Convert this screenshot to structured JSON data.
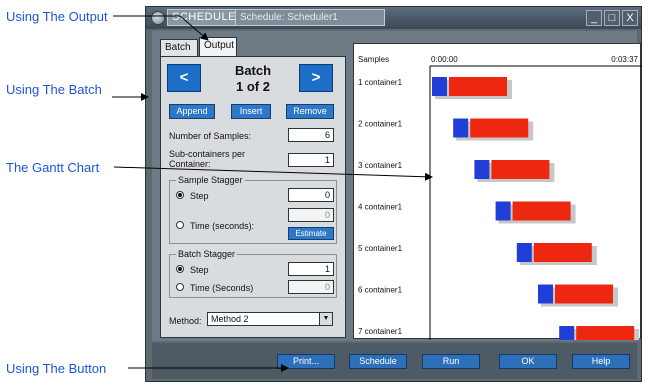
{
  "callouts": {
    "output": "Using The Output",
    "batch": "Using The Batch",
    "gantt": "The Gantt Chart",
    "button": "Using The Button"
  },
  "window": {
    "app_name": "SCHEDULE",
    "title": "Schedule: Scheduler1",
    "min_glyph": "_",
    "max_glyph": "□",
    "close_glyph": "X"
  },
  "tabs": {
    "batch": "Batch",
    "output": "Output"
  },
  "batch": {
    "title": "Batch",
    "counter": "1 of 2",
    "prev_glyph": "<",
    "next_glyph": ">",
    "append_label": "Append",
    "insert_label": "Insert",
    "remove_label": "Remove",
    "num_samples_label": "Number of Samples:",
    "num_samples_value": "6",
    "subcontainers_label": "Sub-containers per Container:",
    "subcontainers_value": "1",
    "sample_stagger": {
      "title": "Sample Stagger",
      "step_label": "Step",
      "step_value": "0",
      "time_label": "Time (seconds):",
      "time_value": "0",
      "estimate_label": "Estimate"
    },
    "batch_stagger": {
      "title": "Batch Stagger",
      "step_label": "Step",
      "step_value": "1",
      "time_label": "Time (Seconds)",
      "time_value": "0"
    },
    "method_label": "Method:",
    "method_value": "Method 2"
  },
  "gantt": {
    "header_samples": "Samples",
    "time_start": "0:00:00",
    "time_end": "0:03:37",
    "colors": {
      "step_a": "#1f3fd6",
      "step_b": "#ee2810",
      "shadow": "#c7c7c7"
    },
    "rows": [
      {
        "label": "1 container1"
      },
      {
        "label": "2 container1"
      },
      {
        "label": "3 container1"
      },
      {
        "label": "4 container1"
      },
      {
        "label": "5 container1"
      },
      {
        "label": "6 container1"
      },
      {
        "label": "7 container1"
      }
    ]
  },
  "buttons": {
    "print": "Print...",
    "schedule": "Schedule",
    "run": "Run",
    "ok": "OK",
    "help": "Help"
  }
}
